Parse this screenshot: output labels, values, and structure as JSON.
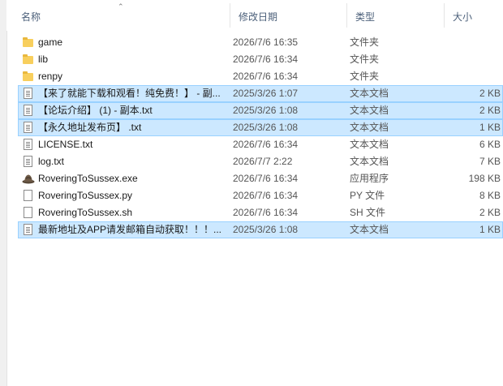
{
  "columns": {
    "name": "名称",
    "date": "修改日期",
    "type": "类型",
    "size": "大小"
  },
  "files": [
    {
      "name": "game",
      "date": "2026/7/6 16:35",
      "type": "文件夹",
      "size": "",
      "icon": "folder-icon",
      "selected": false
    },
    {
      "name": "lib",
      "date": "2026/7/6 16:34",
      "type": "文件夹",
      "size": "",
      "icon": "folder-icon",
      "selected": false
    },
    {
      "name": "renpy",
      "date": "2026/7/6 16:34",
      "type": "文件夹",
      "size": "",
      "icon": "folder-icon",
      "selected": false
    },
    {
      "name": "【来了就能下载和观看！纯免费！】 - 副...",
      "date": "2025/3/26 1:07",
      "type": "文本文档",
      "size": "2 KB",
      "icon": "text-file-icon",
      "selected": true
    },
    {
      "name": "【论坛介绍】 (1) - 副本.txt",
      "date": "2025/3/26 1:08",
      "type": "文本文档",
      "size": "2 KB",
      "icon": "text-file-icon",
      "selected": true
    },
    {
      "name": "【永久地址发布页】 .txt",
      "date": "2025/3/26 1:08",
      "type": "文本文档",
      "size": "1 KB",
      "icon": "text-file-icon",
      "selected": true
    },
    {
      "name": "LICENSE.txt",
      "date": "2026/7/6 16:34",
      "type": "文本文档",
      "size": "6 KB",
      "icon": "text-file-icon",
      "selected": false
    },
    {
      "name": "log.txt",
      "date": "2026/7/7 2:22",
      "type": "文本文档",
      "size": "7 KB",
      "icon": "text-file-icon",
      "selected": false
    },
    {
      "name": "RoveringToSussex.exe",
      "date": "2026/7/6 16:34",
      "type": "应用程序",
      "size": "198 KB",
      "icon": "application-icon",
      "selected": false
    },
    {
      "name": "RoveringToSussex.py",
      "date": "2026/7/6 16:34",
      "type": "PY 文件",
      "size": "8 KB",
      "icon": "file-icon",
      "selected": false
    },
    {
      "name": "RoveringToSussex.sh",
      "date": "2026/7/6 16:34",
      "type": "SH 文件",
      "size": "2 KB",
      "icon": "file-icon",
      "selected": false
    },
    {
      "name": "最新地址及APP请发邮箱自动获取！！！...",
      "date": "2025/3/26 1:08",
      "type": "文本文档",
      "size": "1 KB",
      "icon": "text-file-icon",
      "selected": true
    }
  ],
  "colors": {
    "selection_bg": "#cce8ff",
    "selection_border": "#99d1ff",
    "header_text": "#4c607a",
    "folder": "#f8cf5d"
  }
}
